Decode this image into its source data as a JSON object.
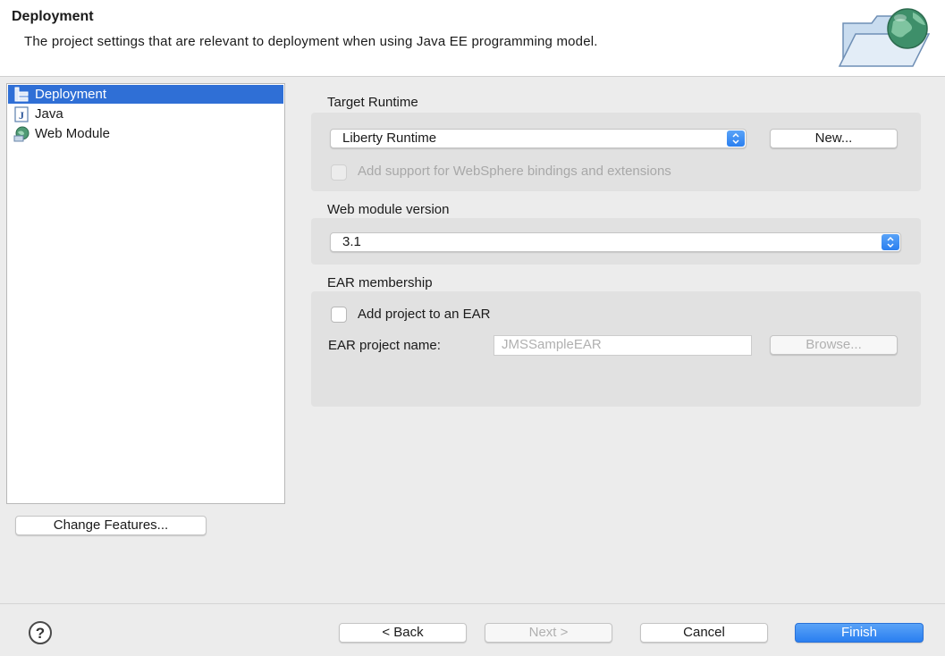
{
  "header": {
    "title": "Deployment",
    "description": "The project settings that are relevant to deployment when using Java EE programming model.",
    "icon": "folder-globe-icon"
  },
  "tree": {
    "items": [
      {
        "label": "Deployment",
        "icon": "deployment-icon",
        "selected": true
      },
      {
        "label": "Java",
        "icon": "java-icon",
        "selected": false
      },
      {
        "label": "Web Module",
        "icon": "web-module-icon",
        "selected": false
      }
    ]
  },
  "change_features_label": "Change Features...",
  "target_runtime": {
    "label": "Target Runtime",
    "value": "Liberty Runtime",
    "new_label": "New...",
    "websphere_label": "Add support for WebSphere bindings and extensions"
  },
  "web_module": {
    "label": "Web module version",
    "value": "3.1"
  },
  "ear": {
    "label": "EAR membership",
    "add_label": "Add project to an EAR",
    "name_label": "EAR project name:",
    "name_value": "JMSSampleEAR",
    "browse_label": "Browse..."
  },
  "footer": {
    "back_label": "< Back",
    "next_label": "Next >",
    "cancel_label": "Cancel",
    "finish_label": "Finish",
    "help_icon": "help-icon"
  },
  "colors": {
    "accent": "#2a7ff0",
    "selection": "#2f6fd6"
  }
}
